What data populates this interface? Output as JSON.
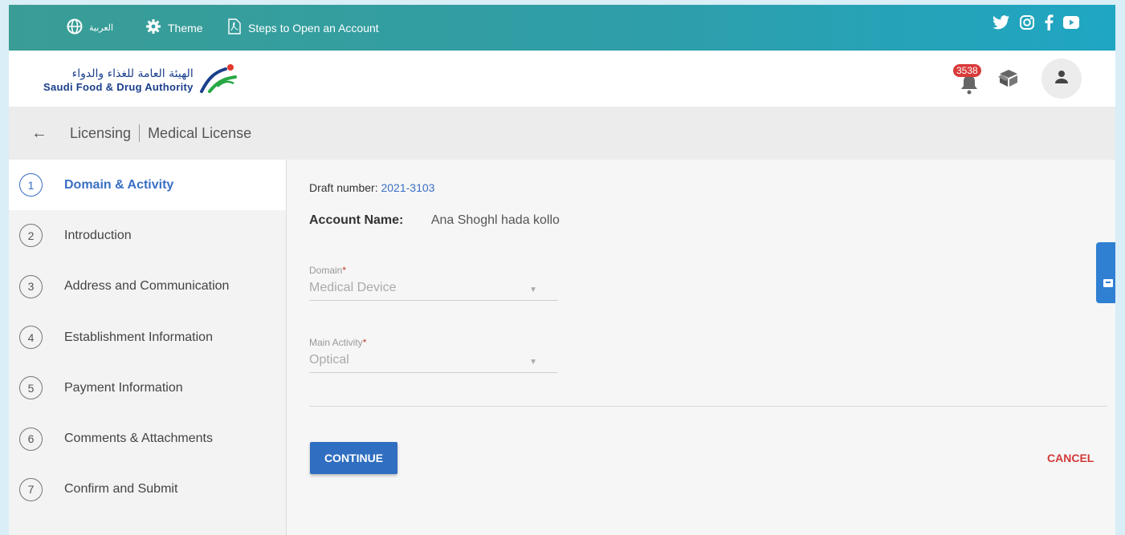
{
  "topbar": {
    "language_label": "العربية",
    "theme_label": "Theme",
    "steps_label": "Steps to Open an Account"
  },
  "header": {
    "logo_arabic": "الهيئة العامة للغذاء والدواء",
    "logo_english": "Saudi Food & Drug Authority",
    "notification_count": "3538"
  },
  "breadcrumb": {
    "section": "Licensing",
    "page": "Medical License"
  },
  "steps": [
    {
      "num": "1",
      "label": "Domain & Activity",
      "active": true
    },
    {
      "num": "2",
      "label": "Introduction"
    },
    {
      "num": "3",
      "label": "Address and Communication"
    },
    {
      "num": "4",
      "label": "Establishment Information"
    },
    {
      "num": "5",
      "label": "Payment Information"
    },
    {
      "num": "6",
      "label": "Comments & Attachments"
    },
    {
      "num": "7",
      "label": "Confirm and Submit"
    }
  ],
  "form": {
    "draft_label": "Draft number:",
    "draft_value": "2021-3103",
    "account_label": "Account Name:",
    "account_value": "Ana Shoghl hada kollo",
    "domain_label": "Domain",
    "domain_value": "Medical Device",
    "activity_label": "Main Activity",
    "activity_value": "Optical",
    "required_mark": "*",
    "continue_label": "CONTINUE",
    "cancel_label": "CANCEL"
  },
  "colors": {
    "accent": "#2f6ec0",
    "cancel": "#d33a3a",
    "badge": "#d93a3a"
  }
}
